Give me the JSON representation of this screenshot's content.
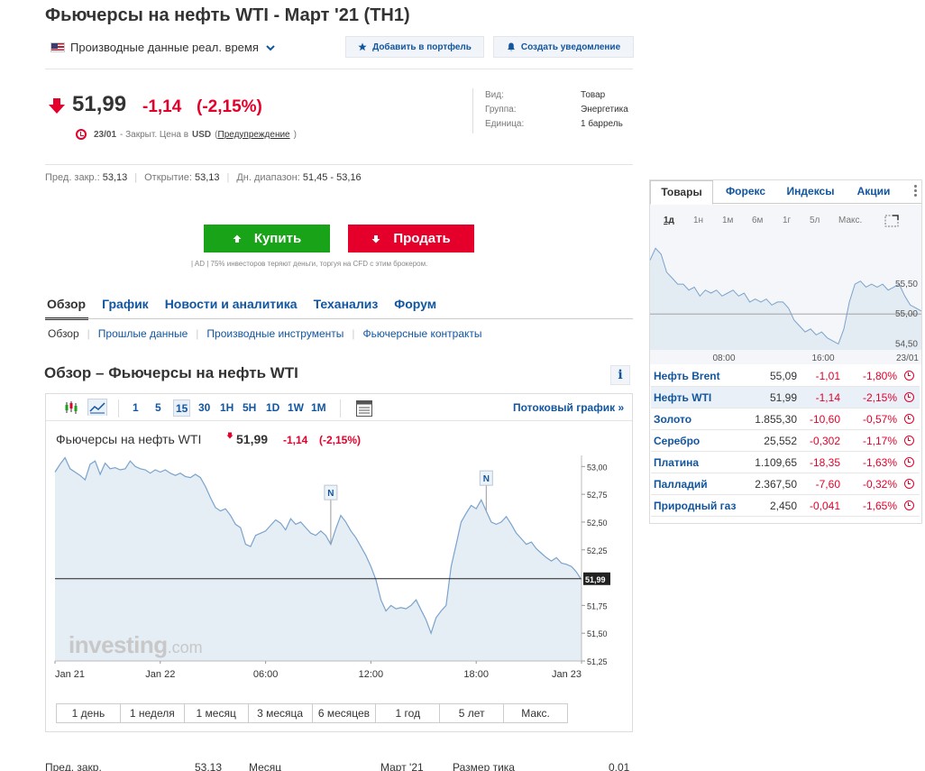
{
  "header": {
    "title": "Фьючерсы на нефть WTI - Март '21 (TH1)",
    "realtime_label": "Производные данные реал. время",
    "add_portfolio": "Добавить в портфель",
    "create_alert": "Создать уведомление"
  },
  "quote": {
    "price": "51,99",
    "change": "-1,14",
    "change_pct": "(-2,15%)",
    "date": "23/01",
    "closed_text": "- Закрыт. Цена в",
    "currency": "USD",
    "paren_open": "(",
    "warning": "Предупреждение",
    "paren_close": ")"
  },
  "info": [
    {
      "k": "Вид:",
      "v": "Товар"
    },
    {
      "k": "Группа:",
      "v": "Энергетика"
    },
    {
      "k": "Единица:",
      "v": "1 баррель"
    }
  ],
  "stats": {
    "prev_close_label": "Пред. закр.:",
    "prev_close": "53,13",
    "open_label": "Открытие:",
    "open": "53,13",
    "range_label": "Дн. диапазон:",
    "range": "51,45 - 53,16"
  },
  "trade": {
    "buy": "Купить",
    "sell": "Продать",
    "disclaimer": "| AD | 75% инвесторов теряют деньги, торгуя на CFD с этим брокером."
  },
  "tabs": [
    "Обзор",
    "График",
    "Новости и аналитика",
    "Теханализ",
    "Форум"
  ],
  "subtabs": [
    "Обзор",
    "Прошлые данные",
    "Производные инструменты",
    "Фьючерсные контракты"
  ],
  "section_title": "Обзор – Фьючерсы на нефть WTI",
  "info_icon": "i",
  "chart_toolbar": {
    "timeframes": [
      "1",
      "5",
      "15",
      "30",
      "1H",
      "5H",
      "1D",
      "1W",
      "1M"
    ],
    "active": "15",
    "stream_link": "Потоковый график »"
  },
  "chart_header": {
    "name": "Фьючерсы на нефть WTI",
    "price": "51,99",
    "change": "-1,14",
    "change_pct": "(-2,15%)"
  },
  "watermark": {
    "bold": "investing",
    "light": ".com"
  },
  "news_marker": "N",
  "periods": [
    "1 день",
    "1 неделя",
    "1 месяц",
    "3 месяца",
    "6 месяцев",
    "1 год",
    "5 лет",
    "Макс."
  ],
  "bottom": {
    "prev_close_label": "Пред. закр.",
    "prev_close": "53,13",
    "month_label": "Месяц",
    "month": "Март '21",
    "tick_label": "Размер тика",
    "tick": "0,01"
  },
  "chart_data": [
    {
      "type": "area",
      "title": "",
      "x_ticks": [
        "Jan 21",
        "Jan 22",
        "06:00",
        "12:00",
        "18:00",
        "Jan 23"
      ],
      "y_ticks": [
        "53,00",
        "52,75",
        "52,50",
        "52,25",
        "51,75",
        "51,50",
        "51,25"
      ],
      "ylim": [
        51.25,
        53.1
      ],
      "prev_close": 53.13,
      "last": 51.99,
      "last_label": "51,99",
      "series": [
        {
          "values": [
            52.95,
            53.02,
            53.08,
            52.98,
            52.95,
            52.92,
            52.88,
            53.02,
            53.05,
            52.93,
            53.03,
            52.98,
            52.99,
            52.97,
            52.98,
            53.05,
            53.0,
            52.98,
            52.97,
            52.94,
            52.97,
            52.95,
            52.97,
            52.94,
            52.92,
            52.94,
            52.91,
            52.9,
            52.93,
            52.9,
            52.82,
            52.72,
            52.63,
            52.6,
            52.62,
            52.56,
            52.48,
            52.45,
            52.3,
            52.28,
            52.38,
            52.4,
            52.42,
            52.47,
            52.52,
            52.49,
            52.43,
            52.53,
            52.48,
            52.5,
            52.45,
            52.4,
            52.38,
            52.42,
            52.38,
            52.3,
            52.44,
            52.56,
            52.5,
            52.42,
            52.36,
            52.28,
            52.2,
            52.1,
            51.98,
            51.8,
            51.7,
            51.75,
            51.72,
            51.73,
            51.72,
            51.75,
            51.8,
            51.71,
            51.62,
            51.5,
            51.64,
            51.7,
            51.75,
            52.1,
            52.3,
            52.5,
            52.58,
            52.65,
            52.62,
            52.7,
            52.6,
            52.5,
            52.48,
            52.5,
            52.55,
            52.48,
            52.4,
            52.35,
            52.3,
            52.32,
            52.26,
            52.22,
            52.18,
            52.15,
            52.18,
            52.13,
            52.12,
            52.1,
            52.05,
            51.98
          ]
        }
      ],
      "news_markers": [
        52.62,
        52.75
      ]
    },
    {
      "type": "area",
      "title": "",
      "x_ticks": [
        "08:00",
        "16:00",
        "23/01"
      ],
      "y_ticks": [
        "55,50",
        "55,00",
        "54,50"
      ],
      "ylim": [
        54.4,
        56.3
      ],
      "series": [
        {
          "values": [
            55.9,
            56.1,
            56.0,
            55.7,
            55.6,
            55.5,
            55.5,
            55.4,
            55.45,
            55.3,
            55.4,
            55.35,
            55.4,
            55.3,
            55.35,
            55.4,
            55.3,
            55.35,
            55.2,
            55.25,
            55.2,
            55.25,
            55.15,
            55.2,
            55.2,
            55.1,
            54.9,
            54.8,
            54.7,
            54.75,
            54.65,
            54.7,
            54.6,
            54.55,
            54.5,
            54.75,
            55.2,
            55.5,
            55.55,
            55.45,
            55.5,
            55.45,
            55.5,
            55.4,
            55.45,
            55.5,
            55.3,
            55.15,
            55.1,
            55.05
          ]
        }
      ]
    }
  ],
  "widget": {
    "tabs": [
      "Товары",
      "Форекс",
      "Индексы",
      "Акции"
    ],
    "timeframes": [
      "1д",
      "1н",
      "1м",
      "6м",
      "1г",
      "5л",
      "Макс."
    ],
    "rows": [
      {
        "name": "Нефть Brent",
        "price": "55,09",
        "change": "-1,01",
        "pct": "-1,80%"
      },
      {
        "name": "Нефть WTI",
        "price": "51,99",
        "change": "-1,14",
        "pct": "-2,15%"
      },
      {
        "name": "Золото",
        "price": "1.855,30",
        "change": "-10,60",
        "pct": "-0,57%"
      },
      {
        "name": "Серебро",
        "price": "25,552",
        "change": "-0,302",
        "pct": "-1,17%"
      },
      {
        "name": "Платина",
        "price": "1.109,65",
        "change": "-18,35",
        "pct": "-1,63%"
      },
      {
        "name": "Палладий",
        "price": "2.367,50",
        "change": "-7,60",
        "pct": "-0,32%"
      },
      {
        "name": "Природный газ",
        "price": "2,450",
        "change": "-0,041",
        "pct": "-1,65%"
      }
    ]
  },
  "colors": {
    "red": "#e4002b",
    "green": "#19a319",
    "link": "#1256a0"
  }
}
